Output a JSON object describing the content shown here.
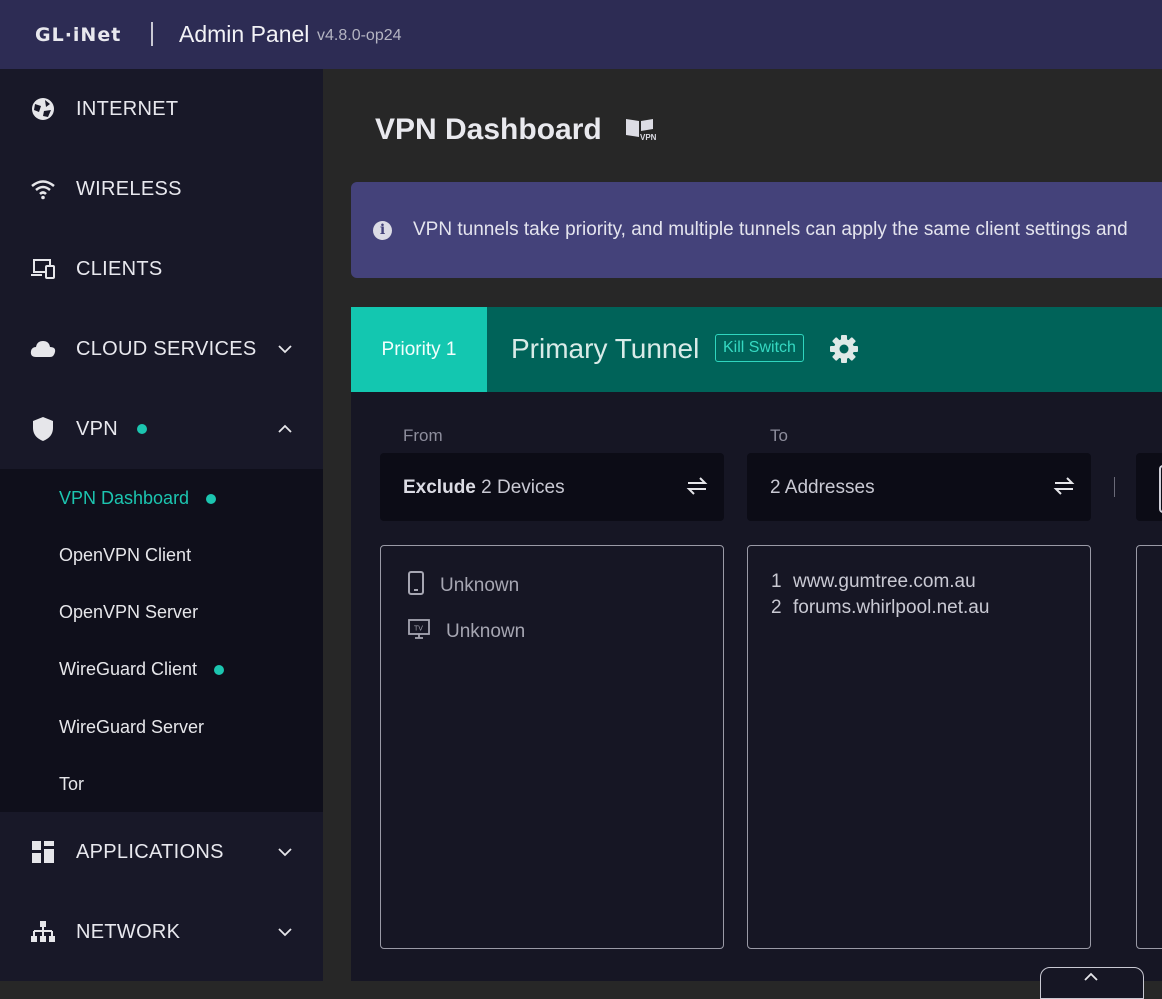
{
  "header": {
    "logo": "GL·iNet",
    "title": "Admin Panel",
    "version": "v4.8.0-op24"
  },
  "sidebar": {
    "items": [
      {
        "label": "INTERNET",
        "icon": "globe-icon"
      },
      {
        "label": "WIRELESS",
        "icon": "wifi-icon"
      },
      {
        "label": "CLIENTS",
        "icon": "devices-icon"
      },
      {
        "label": "CLOUD SERVICES",
        "icon": "cloud-icon",
        "expandable": true
      },
      {
        "label": "VPN",
        "icon": "shield-icon",
        "expanded": true,
        "status_dot": true
      },
      {
        "label": "APPLICATIONS",
        "icon": "apps-grid-icon",
        "expandable": true
      },
      {
        "label": "NETWORK",
        "icon": "network-icon",
        "expandable": true
      }
    ],
    "vpn_submenu": [
      {
        "label": "VPN Dashboard",
        "active": true,
        "status_dot": true
      },
      {
        "label": "OpenVPN Client"
      },
      {
        "label": "OpenVPN Server"
      },
      {
        "label": "WireGuard Client",
        "status_dot": true
      },
      {
        "label": "WireGuard Server"
      },
      {
        "label": "Tor"
      }
    ]
  },
  "main": {
    "page_title": "VPN Dashboard",
    "banner": "VPN tunnels take priority, and multiple tunnels can apply the same client settings and",
    "tunnel": {
      "priority": "Priority 1",
      "name": "Primary Tunnel",
      "kill_switch": "Kill Switch",
      "from_label": "From",
      "from_mode": "Exclude",
      "from_value": "2 Devices",
      "to_label": "To",
      "to_value": "2 Addresses",
      "devices": [
        {
          "name": "Unknown",
          "icon": "phone-icon"
        },
        {
          "name": "Unknown",
          "icon": "tv-icon"
        }
      ],
      "addresses": [
        {
          "num": "1",
          "host": "www.gumtree.com.au"
        },
        {
          "num": "2",
          "host": "forums.whirlpool.net.au"
        }
      ]
    }
  },
  "colors": {
    "accent": "#1cc5b0",
    "header_bg": "#2d2c54",
    "banner_bg": "#44427a",
    "tunnel_header": "#006359"
  }
}
